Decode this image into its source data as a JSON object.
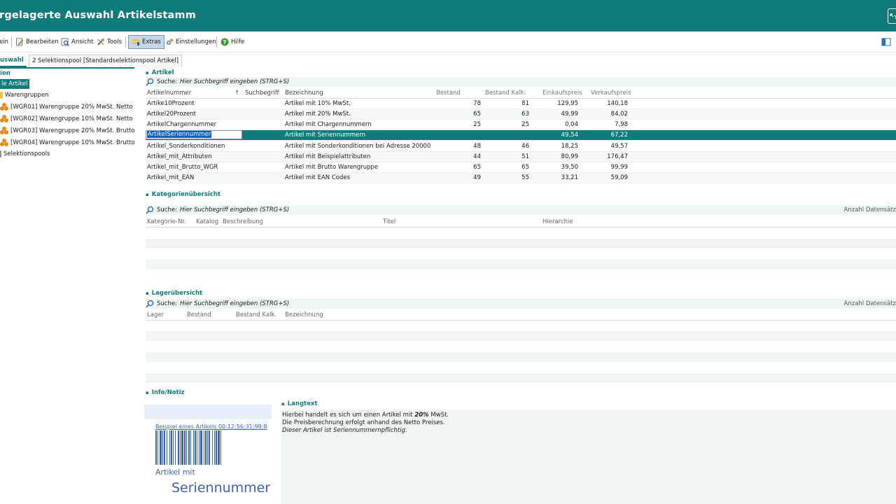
{
  "window": {
    "title": "rgelagerte Auswahl Artikelstamm"
  },
  "toolbar": {
    "items": [
      {
        "label": "ein",
        "icon": ""
      },
      {
        "label": "Bearbeiten",
        "icon": "edit-icon"
      },
      {
        "label": "Ansicht",
        "icon": "view-icon"
      },
      {
        "label": "Tools",
        "icon": "tools-icon"
      },
      {
        "label": "Extras",
        "icon": "extras-icon"
      },
      {
        "label": "Einstellungen",
        "icon": "settings-icon"
      },
      {
        "label": "Hilfe",
        "icon": "help-icon"
      }
    ]
  },
  "tabs": {
    "tab1": "uswahl",
    "tab2": "2 Selektionspool [Standardselektionspool Artikel]"
  },
  "left": {
    "header": "ion",
    "items": [
      {
        "label": "le Artikel"
      },
      {
        "label": "Warengruppen"
      },
      {
        "label": "[WGR01] Warengruppe 20% MwSt. Netto"
      },
      {
        "label": "[WGR02] Warengruppe 10% MwSt. Netto"
      },
      {
        "label": "[WGR03] Warengruppe 20% MwSt. Brutto"
      },
      {
        "label": "[WGR04] Warengruppe 10% MwSt. Brutto"
      },
      {
        "label": "Selektionspools"
      }
    ]
  },
  "artikel": {
    "title": "Artikel",
    "search_label": "Suche:",
    "search_placeholder": "Hier Suchbegriff eingeben (STRG+S)",
    "columns": {
      "artikelnummer": "Artikelnummer",
      "sort": "↑",
      "suchbegriff": "Suchbegriff",
      "bezeichnung": "Bezeichnung",
      "bestand": "Bestand",
      "bestand_kalk": "Bestand Kalk.",
      "einkaufspreis": "Einkaufspreis",
      "verkaufspreis": "Verkaufspreis"
    },
    "rows": [
      {
        "nr": "Artike10Prozent",
        "bez": "Artikel mit 10% MwSt.",
        "bestand": "78",
        "kalk": "81",
        "ek": "129,95",
        "vk": "140,18"
      },
      {
        "nr": "Artikel20Prozent",
        "bez": "Artikel mit 20% MwSt.",
        "bestand": "65",
        "kalk": "63",
        "ek": "49,99",
        "vk": "84,02"
      },
      {
        "nr": "ArtikelChargennummer",
        "bez": "Artikel mit Chargennummern",
        "bestand": "25",
        "kalk": "25",
        "ek": "0,04",
        "vk": "7,98"
      },
      {
        "nr": "ArtikelSeriennummer",
        "bez": "Artikel mit Seriennummern",
        "bestand": "",
        "kalk": "",
        "ek": "49,54",
        "vk": "67,22"
      },
      {
        "nr": "Artikel_Sonderkonditionen",
        "bez": "Artikel mit Sonderkonditionen bei Adresse 20000",
        "bestand": "48",
        "kalk": "46",
        "ek": "18,25",
        "vk": "49,57"
      },
      {
        "nr": "Artikel_mit_Attributen",
        "bez": "Artikel mit Beispielattributen",
        "bestand": "44",
        "kalk": "51",
        "ek": "80,99",
        "vk": "176,47"
      },
      {
        "nr": "Artikel_mit_Brutto_WGR",
        "bez": "Artikel mit Brutto Warengruppe",
        "bestand": "65",
        "kalk": "65",
        "ek": "39,50",
        "vk": "99,99"
      },
      {
        "nr": "Artikel_mit_EAN",
        "bez": "Artikel mit EAN Codes",
        "bestand": "49",
        "kalk": "55",
        "ek": "33,21",
        "vk": "59,09"
      }
    ]
  },
  "kategorie": {
    "title": "Kategorienübersicht",
    "search_label": "Suche:",
    "search_placeholder": "Hier Suchbegriff eingeben (STRG+S)",
    "count_label": "Anzahl Datensätz",
    "columns": {
      "nr": "Kategorie-Nr.",
      "katalog": "Katalog",
      "beschreibung": "Beschreibung",
      "titel": "Titel",
      "hierarchie": "Hierarchie"
    }
  },
  "lager": {
    "title": "Lagerübersicht",
    "search_label": "Suche:",
    "search_placeholder": "Hier Suchbegriff eingeben (STRG+S)",
    "count_label": "Anzahl Datensätz",
    "columns": {
      "lager": "Lager",
      "bestand": "Bestand",
      "kalk": "Bestand Kalk.",
      "bezeichnung": "Bezeichnung"
    }
  },
  "info": {
    "title": "Info/Notiz",
    "barcode_text": "Beispiel eines Artikels 00:12:56:31:98:8",
    "image_line1": "Artikel mit",
    "image_line2": "Seriennummer",
    "langtext_title": "Langtext",
    "line1_a": "Hierbei handelt es sich um einen Artikel mit ",
    "line1_b": "20%",
    "line1_c": " MwSt.",
    "line2": "Die Preisberechnung erfolgt anhand des Netto Preises.",
    "line3": "Dieser Artikel ist Seriennummernpflichtig."
  },
  "colors": {
    "accent": "#0f7b7b",
    "warengruppe": "#e38b1b",
    "barcode": "#3a63b8"
  }
}
